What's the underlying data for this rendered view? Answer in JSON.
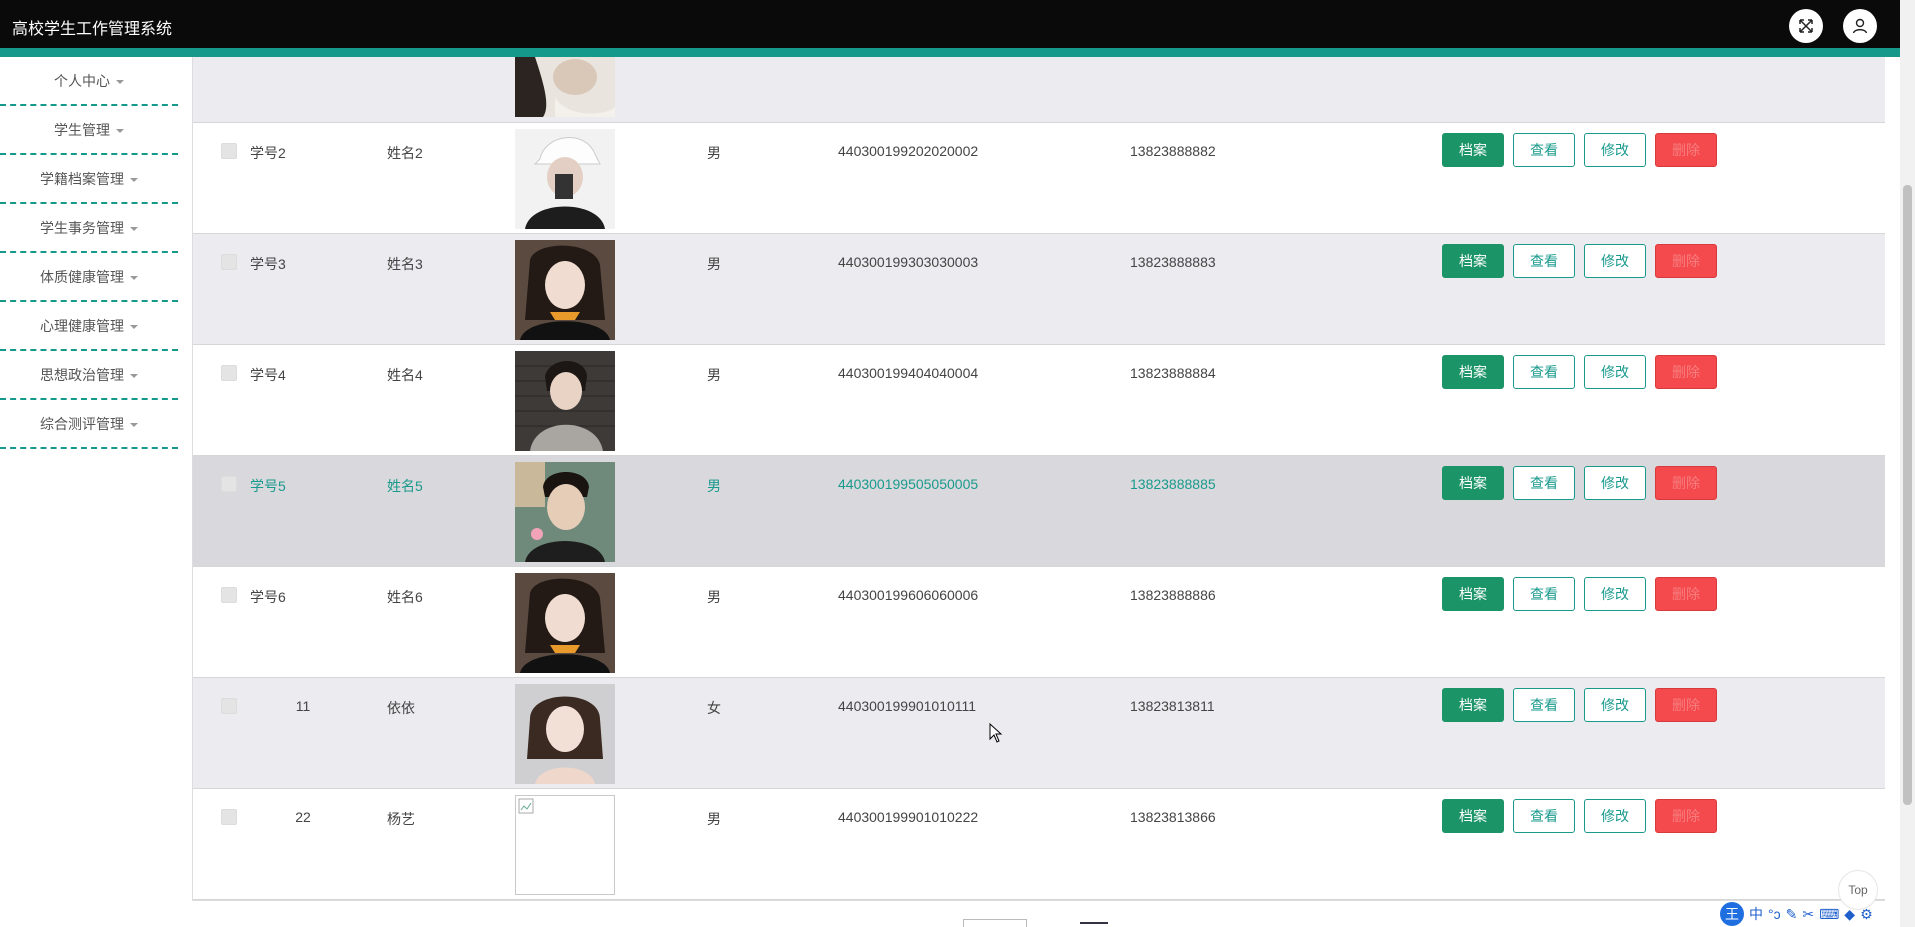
{
  "app": {
    "title": "高校学生工作管理系统"
  },
  "sidebar": {
    "items": [
      {
        "label": "个人中心"
      },
      {
        "label": "学生管理"
      },
      {
        "label": "学籍档案管理"
      },
      {
        "label": "学生事务管理"
      },
      {
        "label": "体质健康管理"
      },
      {
        "label": "心理健康管理"
      },
      {
        "label": "思想政治管理"
      },
      {
        "label": "综合测评管理"
      }
    ]
  },
  "table": {
    "rows": [
      {
        "id": "学号2",
        "name": "姓名2",
        "gender": "男",
        "idcard": "440300199202020002",
        "phone": "13823888882"
      },
      {
        "id": "学号3",
        "name": "姓名3",
        "gender": "男",
        "idcard": "440300199303030003",
        "phone": "13823888883"
      },
      {
        "id": "学号4",
        "name": "姓名4",
        "gender": "男",
        "idcard": "440300199404040004",
        "phone": "13823888884"
      },
      {
        "id": "学号5",
        "name": "姓名5",
        "gender": "男",
        "idcard": "440300199505050005",
        "phone": "13823888885"
      },
      {
        "id": "学号6",
        "name": "姓名6",
        "gender": "男",
        "idcard": "440300199606060006",
        "phone": "13823888886"
      },
      {
        "id": "11",
        "name": "依依",
        "gender": "女",
        "idcard": "440300199901010111",
        "phone": "13823813811"
      },
      {
        "id": "22",
        "name": "杨艺",
        "gender": "男",
        "idcard": "440300199901010222",
        "phone": "13823813866"
      }
    ],
    "actions": {
      "archive": "档案",
      "view": "查看",
      "edit": "修改",
      "delete": "删除"
    }
  },
  "misc": {
    "top_button": "Top"
  },
  "ime": {
    "brand": "王",
    "mode": "中"
  },
  "colors": {
    "accent": "#14998a",
    "archive": "#1b9468",
    "delete": "#f44a4d",
    "header": "#0a0a0a"
  }
}
